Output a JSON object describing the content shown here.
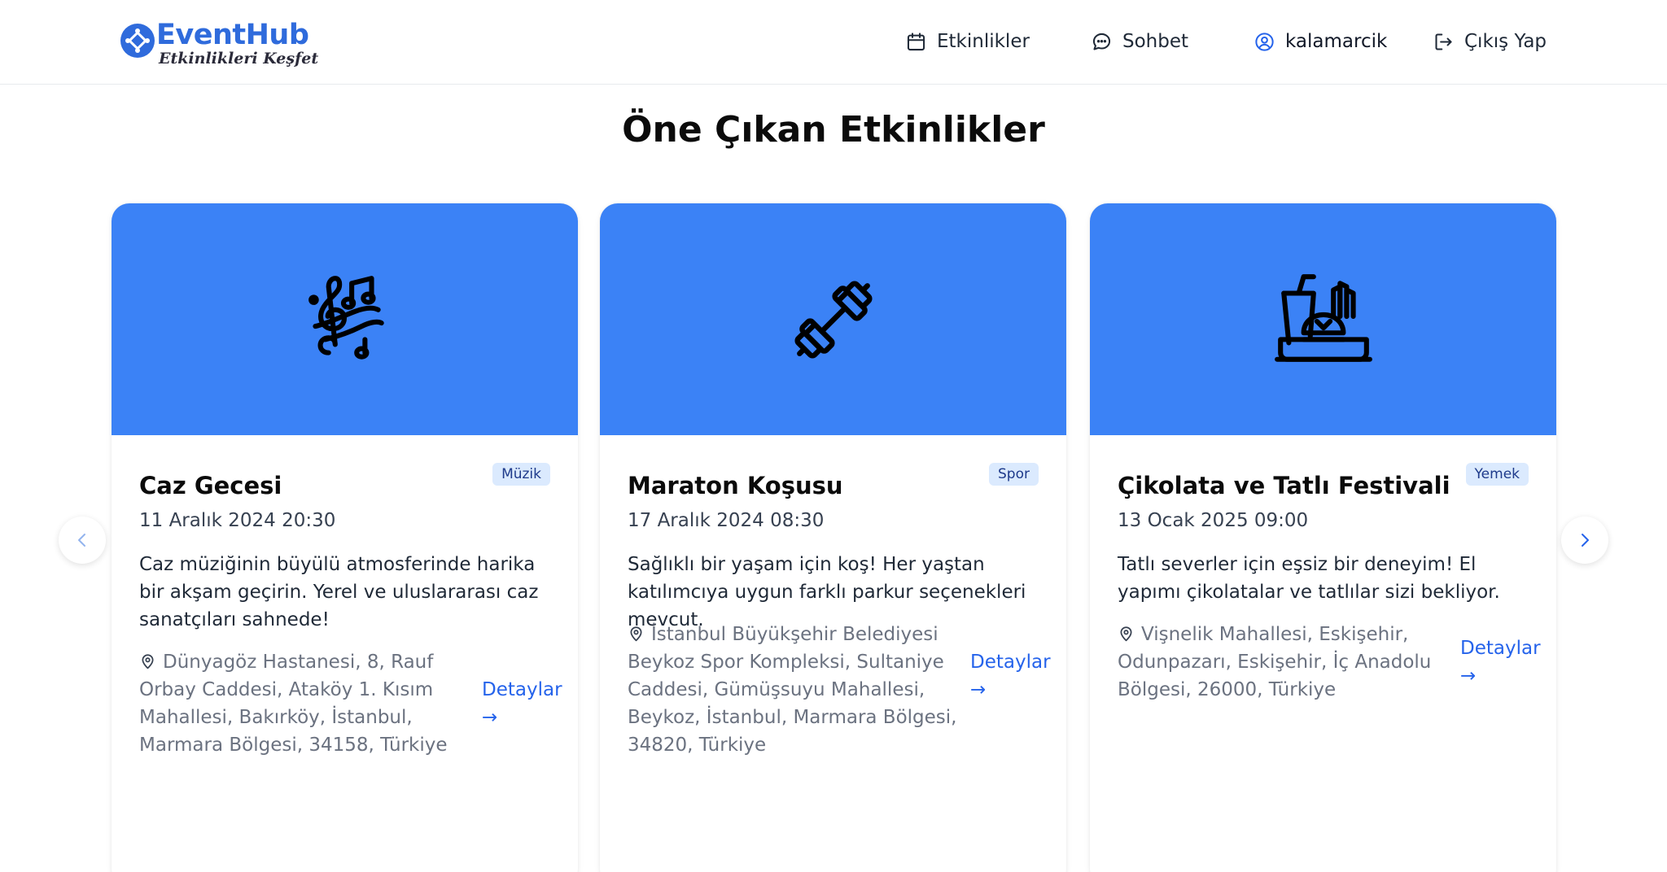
{
  "brand": {
    "name": "EventHub",
    "tagline": "Etkinlikleri Keşfet",
    "color": "#2f6bdc"
  },
  "nav": {
    "events_label": "Etkinlikler",
    "chat_label": "Sohbet",
    "username": "kalamarcik",
    "logout_label": "Çıkış Yap"
  },
  "page": {
    "title": "Öne Çıkan Etkinlikler"
  },
  "cards": [
    {
      "title": "Caz Gecesi",
      "category": "Müzik",
      "date": "11 Aralık 2024 20:30",
      "description": "Caz müziğinin büyülü atmosferinde harika bir akşam geçirin. Yerel ve uluslararası caz sanatçıları sahnede!",
      "location": "Dünyagöz Hastanesi, 8, Rauf Orbay Caddesi, Ataköy 1. Kısım Mahallesi, Bakırköy, İstanbul, Marmara Bölgesi, 34158, Türkiye",
      "link_label": "Detaylar →",
      "icon": "music-notes-icon"
    },
    {
      "title": "Maraton Koşusu",
      "category": "Spor",
      "date": "17 Aralık 2024 08:30",
      "description": "Sağlıklı bir yaşam için koş! Her yaştan katılımcıya uygun farklı parkur seçenekleri mevcut.",
      "location": "İstanbul Büyükşehir Belediyesi Beykoz Spor Kompleksi, Sultaniye Caddesi, Gümüşsuyu Mahallesi, Beykoz, İstanbul, Marmara Bölgesi, 34820, Türkiye",
      "link_label": "Detaylar →",
      "icon": "dumbbell-icon"
    },
    {
      "title": "Çikolata ve Tatlı Festivali",
      "category": "Yemek",
      "date": "13 Ocak 2025 09:00",
      "description": "Tatlı severler için eşsiz bir deneyim! El yapımı çikolatalar ve tatlılar sizi bekliyor.",
      "location": "Vişnelik Mahallesi, Eskişehir, Odunpazarı, Eskişehir, İç Anadolu Bölgesi, 26000, Türkiye",
      "link_label": "Detaylar →",
      "icon": "fast-food-icon"
    }
  ],
  "colors": {
    "banner": "#3b82f6",
    "badge_bg": "#dbeafe",
    "link": "#2563eb"
  }
}
